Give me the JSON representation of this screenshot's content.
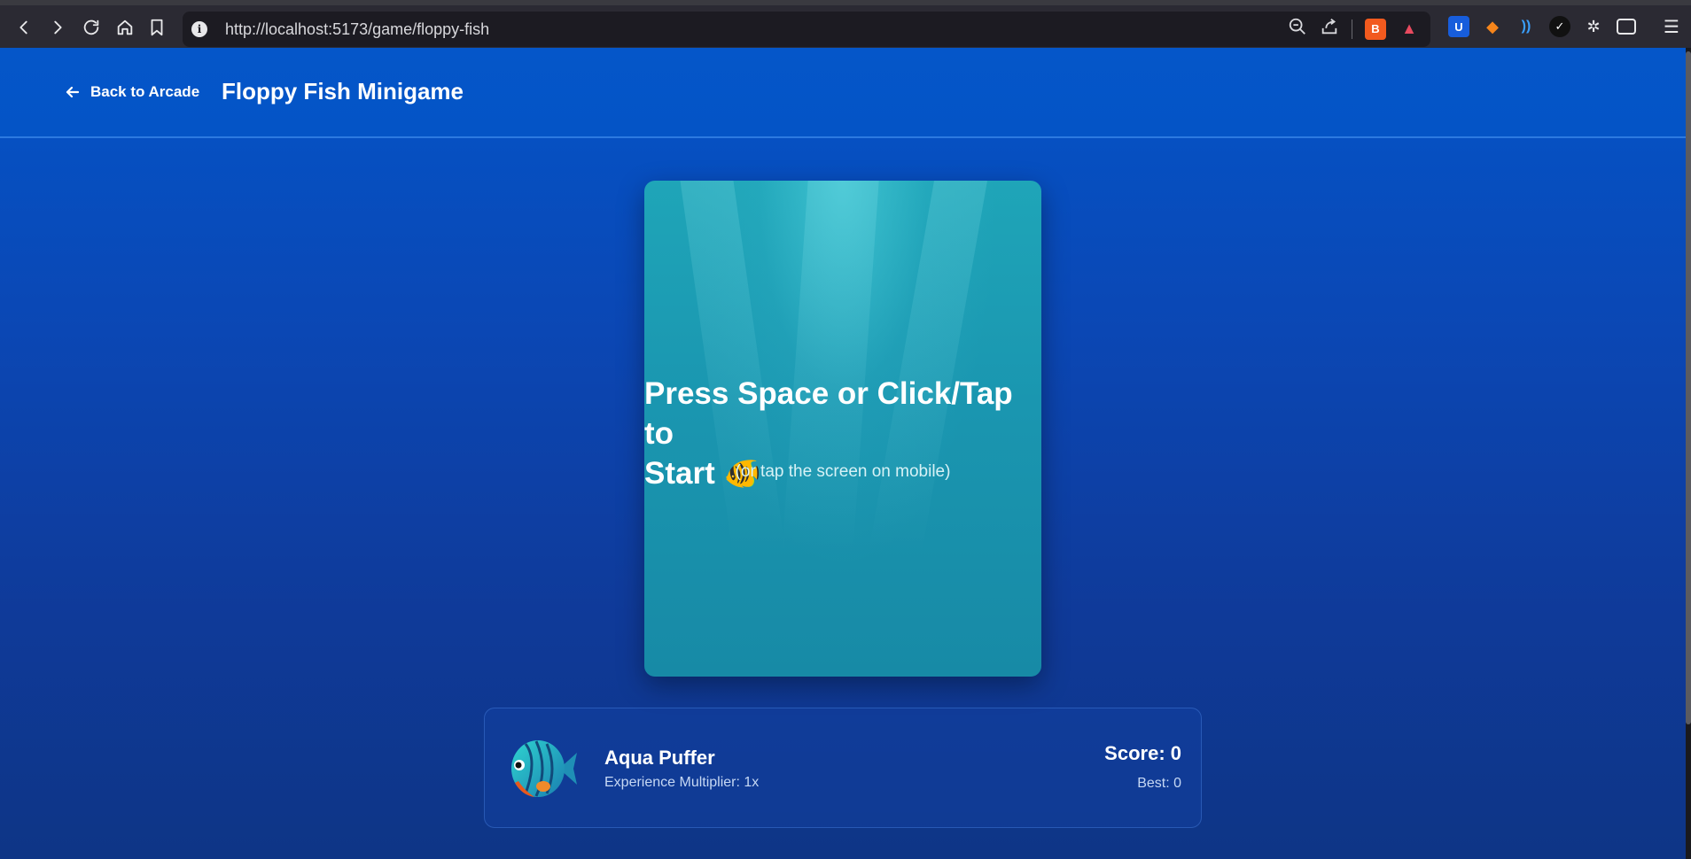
{
  "browser": {
    "url": "http://localhost:5173/game/floppy-fish"
  },
  "header": {
    "back_label": "Back to Arcade",
    "title": "Floppy Fish Minigame"
  },
  "game": {
    "prompt_line1": "Press Space or Click/Tap to",
    "prompt_line2": "Start",
    "prompt_emoji": "🐠",
    "hint": "(or tap the screen on mobile)"
  },
  "player": {
    "fish_name": "Aqua Puffer",
    "multiplier_label": "Experience Multiplier: 1x",
    "score_label": "Score: 0",
    "best_label": "Best: 0"
  },
  "colors": {
    "page_top": "#0354c8",
    "page_bottom": "#0e3586",
    "canvas": "#1a96b0"
  }
}
